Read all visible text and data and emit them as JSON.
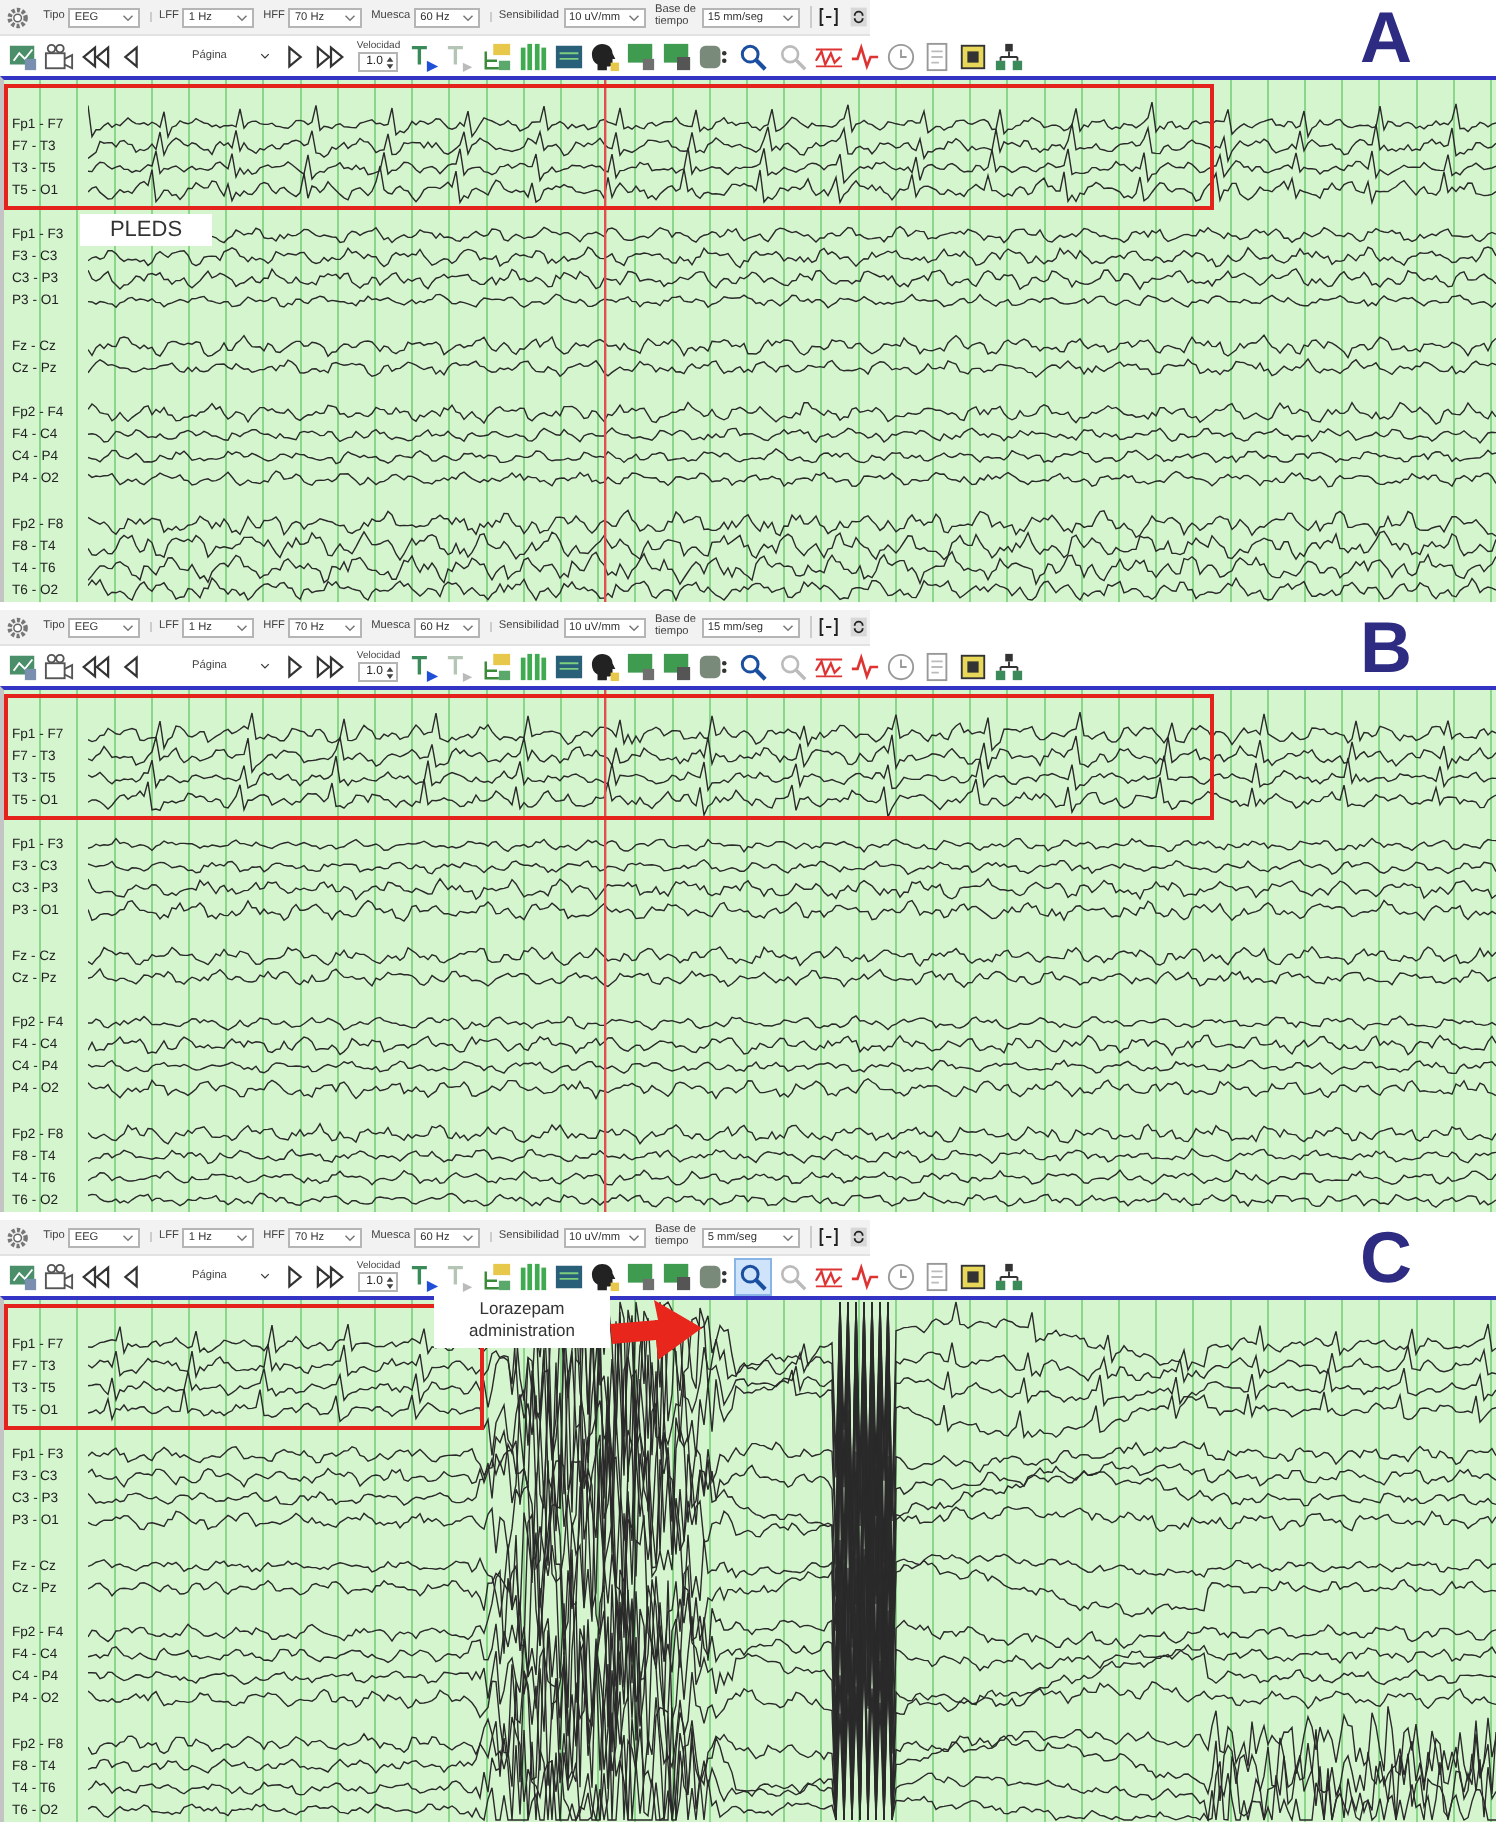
{
  "panels": [
    {
      "letter": "A",
      "kind": "clean",
      "toolbar": {
        "fields": [
          {
            "label": "Tipo",
            "value": "EEG"
          },
          {
            "label": "LFF",
            "value": "1 Hz"
          },
          {
            "label": "HFF",
            "value": "70 Hz"
          },
          {
            "label": "Muesca",
            "value": "60 Hz"
          },
          {
            "label": "Sensibilidad",
            "value": "10 uV/mm"
          },
          {
            "label": "Base de tiempo",
            "value": "15 mm/seg"
          }
        ],
        "page_label": "Página",
        "speed_label": "Velocidad",
        "speed_value": "1.0",
        "zoom_button": {
          "selected": false
        }
      },
      "channel_groups": [
        [
          "Fp1 - F7",
          "F7 - T3",
          "T3 - T5",
          "T5 - O1"
        ],
        [
          "Fp1 - F3",
          "F3 - C3",
          "C3 - P3",
          "P3 - O1"
        ],
        [
          "Fz - Cz",
          "Cz - Pz"
        ],
        [
          "Fp2 - F4",
          "F4 - C4",
          "C4 - P4",
          "P4 - O2"
        ],
        [
          "Fp2 - F8",
          "F8 - T4",
          "T4 - T6",
          "T6 - O2"
        ]
      ],
      "highlight": {
        "kind": "wide"
      },
      "cursor": true,
      "annotation": {
        "kind": "tag",
        "text": "PLEDS"
      }
    },
    {
      "letter": "B",
      "kind": "clean",
      "toolbar": {
        "fields": [
          {
            "label": "Tipo",
            "value": "EEG"
          },
          {
            "label": "LFF",
            "value": "1 Hz"
          },
          {
            "label": "HFF",
            "value": "70 Hz"
          },
          {
            "label": "Muesca",
            "value": "60 Hz"
          },
          {
            "label": "Sensibilidad",
            "value": "10 uV/mm"
          },
          {
            "label": "Base de tiempo",
            "value": "15 mm/seg"
          }
        ],
        "page_label": "Página",
        "speed_label": "Velocidad",
        "speed_value": "1.0",
        "zoom_button": {
          "selected": false
        }
      },
      "channel_groups": [
        [
          "Fp1 - F7",
          "F7 - T3",
          "T3 - T5",
          "T5 - O1"
        ],
        [
          "Fp1 - F3",
          "F3 - C3",
          "C3 - P3",
          "P3 - O1"
        ],
        [
          "Fz - Cz",
          "Cz - Pz"
        ],
        [
          "Fp2 - F4",
          "F4 - C4",
          "C4 - P4",
          "P4 - O2"
        ],
        [
          "Fp2 - F8",
          "F8 - T4",
          "T4 - T6",
          "T6 - O2"
        ]
      ],
      "highlight": {
        "kind": "wide"
      },
      "cursor": true
    },
    {
      "letter": "C",
      "kind": "artifact",
      "toolbar": {
        "fields": [
          {
            "label": "Tipo",
            "value": "EEG"
          },
          {
            "label": "LFF",
            "value": "1 Hz"
          },
          {
            "label": "HFF",
            "value": "70 Hz"
          },
          {
            "label": "Muesca",
            "value": "60 Hz"
          },
          {
            "label": "Sensibilidad",
            "value": "10 uV/mm"
          },
          {
            "label": "Base de tiempo",
            "value": "5 mm/seg"
          }
        ],
        "page_label": "Página",
        "speed_label": "Velocidad",
        "speed_value": "1.0",
        "zoom_button": {
          "selected": true
        }
      },
      "channel_groups": [
        [
          "Fp1 - F7",
          "F7 - T3",
          "T3 - T5",
          "T5 - O1"
        ],
        [
          "Fp1 - F3",
          "F3 - C3",
          "C3 - P3",
          "P3 - O1"
        ],
        [
          "Fz - Cz",
          "Cz - Pz"
        ],
        [
          "Fp2 - F4",
          "F4 - C4",
          "C4 - P4",
          "P4 - O2"
        ],
        [
          "Fp2 - F8",
          "F8 - T4",
          "T4 - T6",
          "T6 - O2"
        ]
      ],
      "highlight": {
        "kind": "narrow"
      },
      "cursor": false,
      "annotation": {
        "kind": "callout",
        "text": "Lorazepam administration"
      }
    }
  ]
}
